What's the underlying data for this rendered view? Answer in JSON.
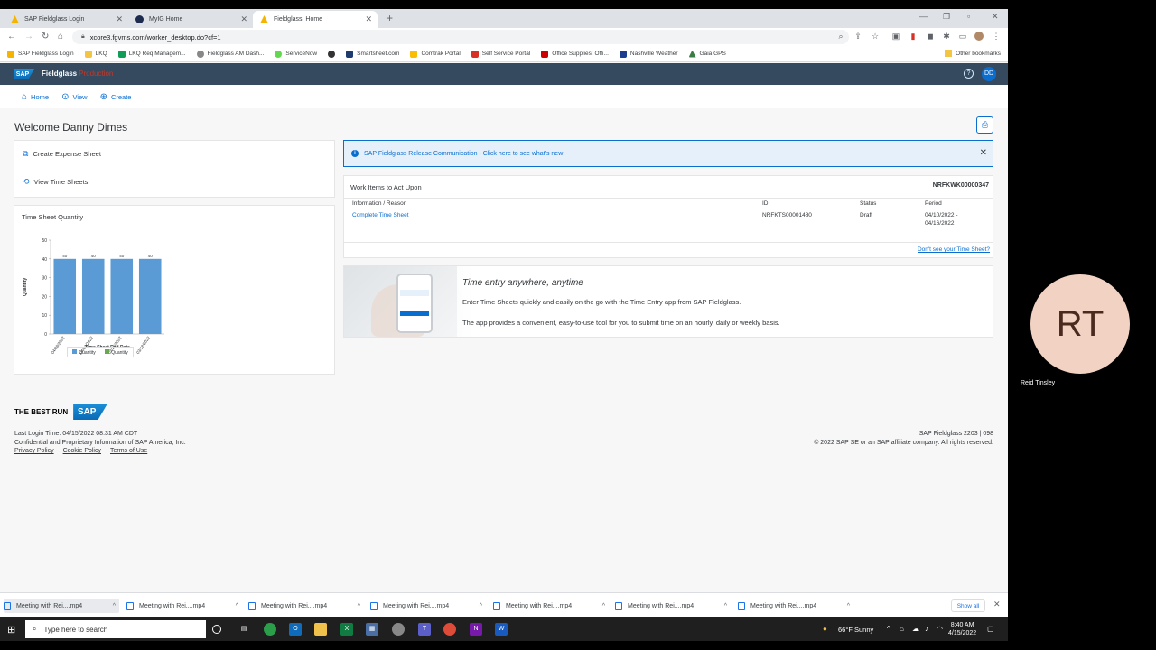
{
  "browser": {
    "tabs": [
      {
        "label": "SAP Fieldglass Login"
      },
      {
        "label": "MyIG Home"
      },
      {
        "label": "Fieldglass: Home"
      }
    ],
    "url": "xcore3.fgvms.com/worker_desktop.do?cf=1",
    "bookmarks": [
      {
        "label": "SAP Fieldglass Login",
        "color": "#f4b400"
      },
      {
        "label": "LKQ",
        "color": "#f4c542"
      },
      {
        "label": "LKQ Req Managem...",
        "color": "#0f9d58"
      },
      {
        "label": "Fieldglass AM Dash...",
        "color": "#888888"
      },
      {
        "label": "ServiceNow",
        "color": "#62d84e"
      },
      {
        "label": "",
        "color": "#333333"
      },
      {
        "label": "Smartsheet.com",
        "color": "#1d3b6e"
      },
      {
        "label": "Comtrak Portal",
        "color": "#fbbc05"
      },
      {
        "label": "Self Service Portal",
        "color": "#d93025"
      },
      {
        "label": "Office Supplies: Offi...",
        "color": "#cc0000"
      },
      {
        "label": "Nashville Weather",
        "color": "#1a3d8f"
      },
      {
        "label": "Gaia GPS",
        "color": "#3a7d44"
      }
    ],
    "other_bookmarks": "Other bookmarks"
  },
  "shell": {
    "product": "Fieldglass",
    "env": "Production",
    "user_initials": "DD",
    "logo": "SAP"
  },
  "subnav": {
    "home": "Home",
    "view": "View",
    "create": "Create"
  },
  "welcome": "Welcome Danny Dimes",
  "quick_links": {
    "expense": "Create Expense Sheet",
    "timesheets": "View Time Sheets"
  },
  "chart_card_title": "Time Sheet Quantity",
  "chart_data": {
    "type": "bar",
    "title": "",
    "categories": [
      "04/08/2022",
      "04/01/2022",
      "03/25/2022",
      "03/18/2022"
    ],
    "values": [
      40,
      40,
      40,
      40
    ],
    "data_labels": [
      "40",
      "40",
      "40",
      "40"
    ],
    "ylim": [
      0,
      50
    ],
    "yticks": [
      0,
      10,
      20,
      30,
      40,
      50
    ],
    "xlabel": "Time Sheet End Date",
    "ylabel": "Quantity",
    "legend": [
      "Quantity",
      "Quantity"
    ],
    "color": "#5b9bd5"
  },
  "banner": {
    "text": "SAP Fieldglass Release Communication - Click here to see what's new"
  },
  "work_items": {
    "title": "Work Items to Act Upon",
    "worker_id": "NRFKWK00000347",
    "headers": [
      "Information / Reason",
      "ID",
      "Status",
      "Period"
    ],
    "rows": [
      {
        "reason": "Complete Time Sheet",
        "id": "NRFKTS00001480",
        "status": "Draft",
        "period_1": "04/10/2022 -",
        "period_2": "04/16/2022"
      }
    ],
    "footer_link": "Don't see your Time Sheet?"
  },
  "promo": {
    "heading": "Time entry anywhere, anytime",
    "line1": "Enter Time Sheets quickly and easily on the go with the Time Entry app from SAP Fieldglass.",
    "line2": "The app provides a convenient, easy-to-use tool for you to submit time on an hourly, daily or weekly basis."
  },
  "footer": {
    "tagline": "THE BEST RUN",
    "logo": "SAP",
    "last_login": "Last Login Time: 04/15/2022 08:31 AM CDT",
    "confidential": "Confidential and Proprietary Information of SAP America, Inc.",
    "links": [
      "Privacy Policy",
      "Cookie Policy",
      "Terms of Use"
    ],
    "version": "SAP Fieldglass 2203 | 098",
    "copyright": "© 2022 SAP SE or an SAP affiliate company. All rights reserved."
  },
  "downloads": {
    "items": [
      "Meeting with Rei....mp4",
      "Meeting with Rei....mp4",
      "Meeting with Rei....mp4",
      "Meeting with Rei....mp4",
      "Meeting with Rei....mp4",
      "Meeting with Rei....mp4",
      "Meeting with Rei....mp4"
    ],
    "show_all": "Show all"
  },
  "participant": {
    "initials": "RT",
    "name": "Reid Tinsley"
  },
  "taskbar": {
    "search_placeholder": "Type here to search",
    "weather": "66°F  Sunny",
    "time": "8:40 AM",
    "date": "4/15/2022"
  }
}
